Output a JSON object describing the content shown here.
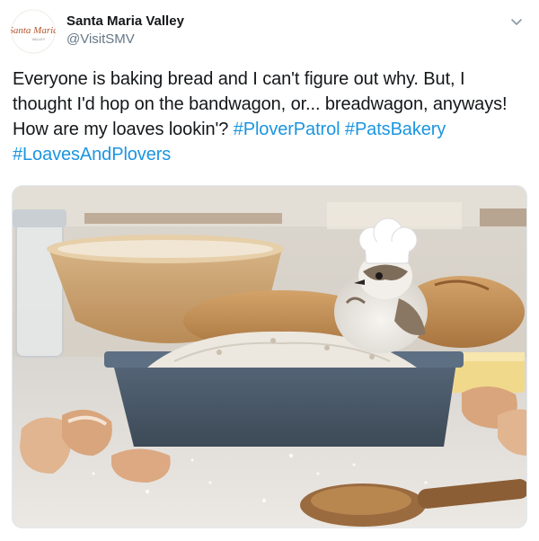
{
  "account": {
    "display_name": "Santa Maria Valley",
    "handle": "@VisitSMV",
    "avatar_icon": "santa-maria-valley-logo",
    "avatar_logo_text": "Santa Maria",
    "avatar_logo_subtext": "VALLEY"
  },
  "tweet": {
    "text": "Everyone is baking bread and I can't figure out why. But, I thought I'd hop on the bandwagon, or... breadwagon, anyways! How are my loaves lookin'?",
    "hashtags": [
      "#PloverPatrol",
      "#PatsBakery",
      "#LoavesAndPlovers"
    ]
  },
  "media": {
    "description_icon": "photo-plover-chef-baking-bread",
    "colors": {
      "hashtag": "#1b95e0",
      "pan": "#4a5866",
      "counter": "#e9e6e2"
    }
  },
  "menu": {
    "icon": "chevron-down-icon"
  }
}
